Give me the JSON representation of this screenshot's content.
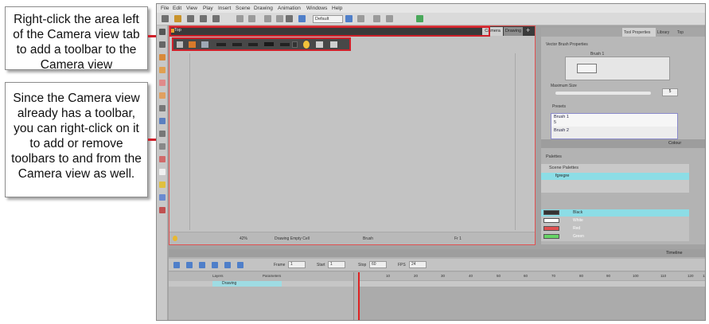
{
  "callouts": {
    "toolbar_hint": "Right-click the area left of the Camera view tab to add a toolbar to the Camera view",
    "existing_toolbar_hint": "Since the Camera view already has a toolbar, you can right-click on it to add or remove toolbars to and from the Camera view as well."
  },
  "colors": {
    "highlight": "#d0202a",
    "camera_toolbar": "#484848",
    "selection": "#8cdde6"
  },
  "menu": [
    "File",
    "Edit",
    "View",
    "Play",
    "Insert",
    "Scene",
    "Drawing",
    "Animation",
    "Windows",
    "Help"
  ],
  "main_toolbar": {
    "preset": "Default"
  },
  "camera_view": {
    "top_label": "Top",
    "tabs": [
      "Camera",
      "Drawing"
    ],
    "status": {
      "zoom": "42%",
      "mode": "Drawing Empty Cell",
      "tool": "Brush",
      "frame": "Fr 1"
    }
  },
  "tool_properties": {
    "tabs": [
      "Tool Properties",
      "Library",
      "Top"
    ],
    "section": "Vector Brush Properties",
    "brush_label": "Brush 1",
    "max_size_label": "Maximum Size",
    "max_size_value": "5",
    "presets_label": "Presets",
    "presets": [
      {
        "name": "Brush 1",
        "size": "5"
      },
      {
        "name": "Brush 2",
        "size": ""
      }
    ]
  },
  "colour": {
    "title": "Colour",
    "palettes_label": "Palettes",
    "scene_palettes_label": "Scene Palettes",
    "palette_name": "fgregre",
    "swatches": [
      {
        "name": "Black",
        "color": "#333333"
      },
      {
        "name": "White",
        "color": "#ffffff"
      },
      {
        "name": "Red",
        "color": "#e05050"
      },
      {
        "name": "Green",
        "color": "#66d466"
      }
    ]
  },
  "timeline": {
    "title": "Timeline",
    "frame_label": "Frame",
    "frame_value": "1",
    "start_label": "Start",
    "start_value": "1",
    "stop_label": "Stop",
    "stop_value": "60",
    "fps_label": "FPS",
    "fps_value": "24",
    "layers_col": "Layers",
    "params_col": "Parameters",
    "layer_name": "Drawing",
    "ruler": [
      "10",
      "20",
      "30",
      "40",
      "50",
      "60",
      "70",
      "80",
      "90",
      "100",
      "110",
      "120",
      "130"
    ]
  }
}
